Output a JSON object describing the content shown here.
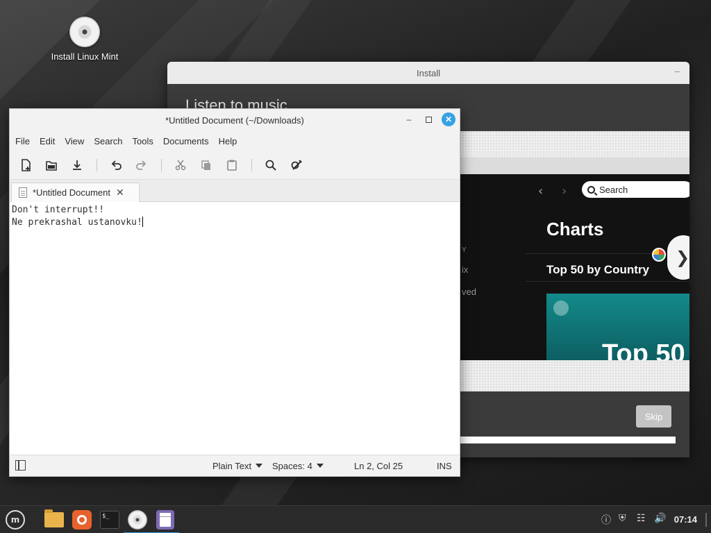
{
  "desktop": {
    "icon_label": "Install Linux Mint"
  },
  "installer": {
    "title": "Install",
    "heading": "Listen to music",
    "skip_label": "Skip",
    "progress_fraction": 0.93,
    "slideshow": {
      "search_placeholder": "Search",
      "charts_title": "Charts",
      "top50_country": "Top 50 by Country",
      "card_text": "Top 50",
      "side_text_1": "Y",
      "side_text_2": "ix",
      "side_text_3": "ved"
    }
  },
  "editor": {
    "title": "*Untitled Document (~/Downloads)",
    "menu": [
      "File",
      "Edit",
      "View",
      "Search",
      "Tools",
      "Documents",
      "Help"
    ],
    "tab_label": "*Untitled Document",
    "lines": [
      "Don't interrupt!!",
      "Ne prekrashal ustanovku!"
    ],
    "status": {
      "language": "Plain Text",
      "spaces": "Spaces: 4",
      "position": "Ln 2, Col 25",
      "mode": "INS"
    }
  },
  "taskbar": {
    "clock": "07:14",
    "accent": "#35a2e3"
  }
}
